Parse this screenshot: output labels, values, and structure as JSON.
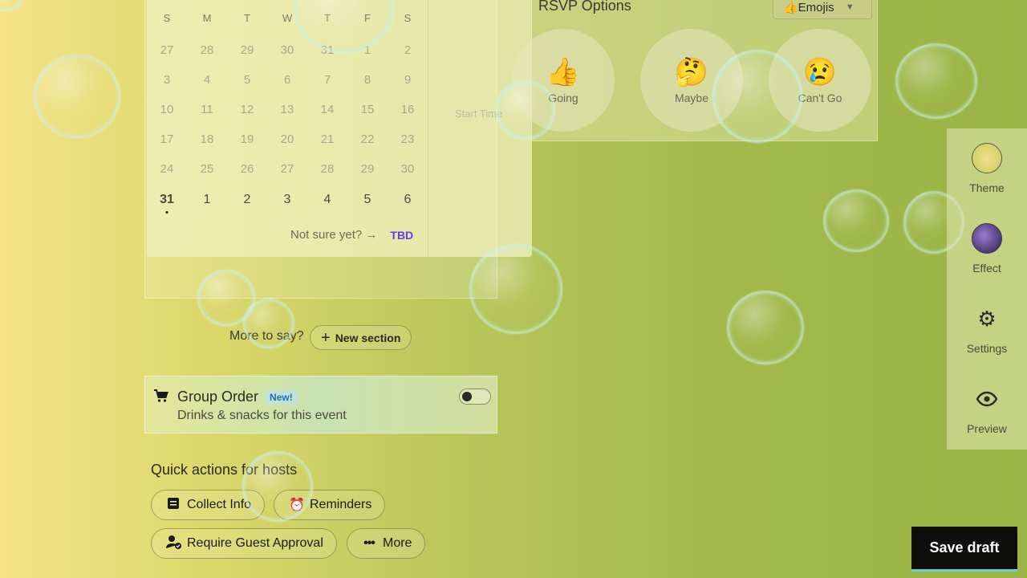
{
  "calendar": {
    "weekdays": [
      "S",
      "M",
      "T",
      "W",
      "T",
      "F",
      "S"
    ],
    "weeks": [
      [
        "27",
        "28",
        "29",
        "30",
        "31",
        "1",
        "2"
      ],
      [
        "3",
        "4",
        "5",
        "6",
        "7",
        "8",
        "9"
      ],
      [
        "10",
        "11",
        "12",
        "13",
        "14",
        "15",
        "16"
      ],
      [
        "17",
        "18",
        "19",
        "20",
        "21",
        "22",
        "23"
      ],
      [
        "24",
        "25",
        "26",
        "27",
        "28",
        "29",
        "30"
      ],
      [
        "31",
        "1",
        "2",
        "3",
        "4",
        "5",
        "6"
      ]
    ],
    "start_time_placeholder": "Start Time",
    "not_sure_label": "Not sure yet? →",
    "tbd_label": "TBD"
  },
  "rsvp": {
    "title": "RSVP Options",
    "style_select": "👍Emojis",
    "options": [
      {
        "emoji": "👍",
        "label": "Going"
      },
      {
        "emoji": "🤔",
        "label": "Maybe"
      },
      {
        "emoji": "😢",
        "label": "Can't Go"
      }
    ]
  },
  "sections": {
    "more_to_say": "More to say?",
    "new_section_label": "New section"
  },
  "group_order": {
    "title": "Group Order",
    "badge": "New!",
    "subtitle": "Drinks & snacks for this event",
    "enabled": false
  },
  "quick_actions": {
    "title": "Quick actions for hosts",
    "buttons": [
      {
        "label": "Collect Info",
        "icon": "form-icon"
      },
      {
        "label": "Reminders",
        "icon": "alarm-clock-icon"
      },
      {
        "label": "Require Guest Approval",
        "icon": "user-check-icon"
      },
      {
        "label": "More",
        "icon": "ellipsis-icon"
      }
    ]
  },
  "sidebar": {
    "items": [
      {
        "label": "Theme"
      },
      {
        "label": "Effect"
      },
      {
        "label": "Settings"
      },
      {
        "label": "Preview"
      }
    ]
  },
  "footer": {
    "save_draft_label": "Save draft"
  }
}
